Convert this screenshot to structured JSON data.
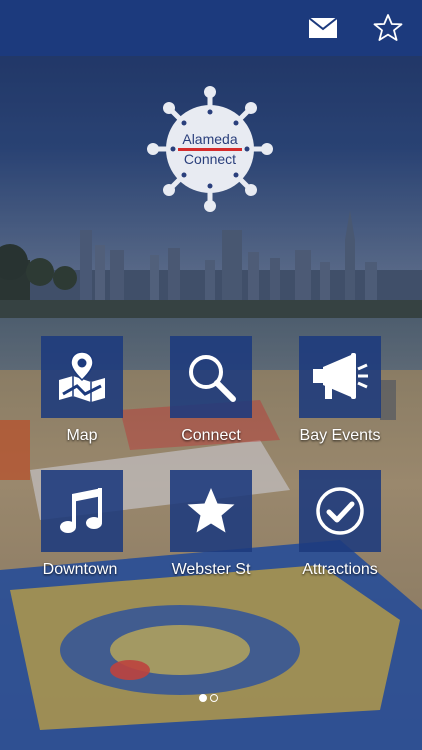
{
  "app": {
    "logo_line1": "Alameda",
    "logo_line2": "Connect"
  },
  "topbar": {
    "mail_icon": "mail-icon",
    "star_icon": "star-outline-icon"
  },
  "tiles": [
    {
      "label": "Map",
      "icon": "map-icon"
    },
    {
      "label": "Connect",
      "icon": "search-icon"
    },
    {
      "label": "Bay Events",
      "icon": "megaphone-icon"
    },
    {
      "label": "Downtown",
      "icon": "music-note-icon"
    },
    {
      "label": "Webster St",
      "icon": "star-icon"
    },
    {
      "label": "Attractions",
      "icon": "check-circle-icon"
    }
  ],
  "pager": {
    "pages": 2,
    "current": 1
  },
  "colors": {
    "topbar": "#1c3a7d",
    "tile": "#1c3a7d",
    "logo_text": "#2a3f7c",
    "logo_accent": "#d52b2b"
  }
}
